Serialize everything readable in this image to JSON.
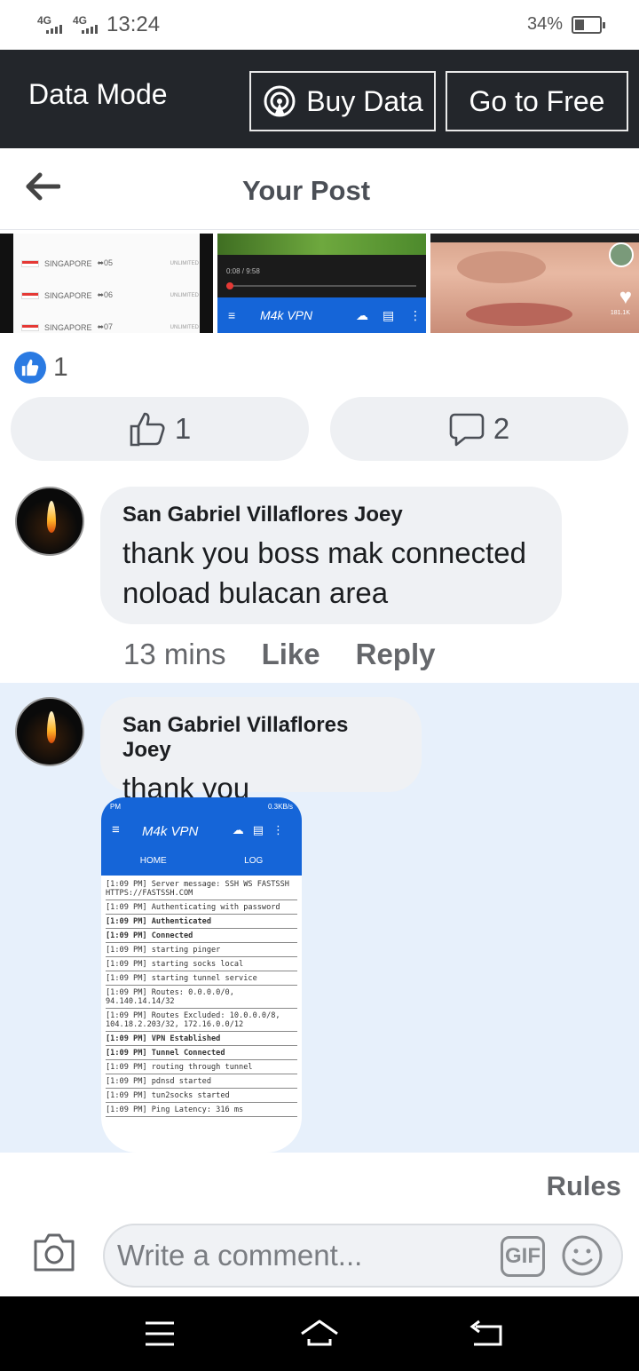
{
  "status_bar": {
    "signal1": "4G",
    "signal2": "4G",
    "time": "13:24",
    "battery": "34%",
    "battery_level": 0.34
  },
  "data_banner": {
    "mode_label": "Data Mode",
    "buy_label": "Buy Data",
    "free_label": "Go to Free"
  },
  "header": {
    "title": "Your Post"
  },
  "thumbnails": {
    "servers": [
      {
        "name": "SINGAPORE",
        "suffix": "05",
        "plan": "UNLIMITED"
      },
      {
        "name": "SINGAPORE",
        "suffix": "06",
        "plan": "UNLIMITED"
      },
      {
        "name": "SINGAPORE",
        "suffix": "07",
        "plan": "UNLIMITED"
      }
    ],
    "video_time": "0:08 / 9:58",
    "video_app": "M4k VPN",
    "like_count_small": "181.1K"
  },
  "reactions": {
    "count": "1"
  },
  "actions": {
    "like_count": "1",
    "comment_count": "2"
  },
  "comments": [
    {
      "author": "San Gabriel Villaflores Joey",
      "text": "thank you boss mak connected noload bulacan area",
      "time": "13 mins",
      "like": "Like",
      "reply": "Reply"
    },
    {
      "author": "San Gabriel Villaflores Joey",
      "text": "thank you"
    }
  ],
  "attachment": {
    "status_time": "PM",
    "status_right": "0.3KB/s",
    "title": "M4k VPN",
    "tab_home": "HOME",
    "tab_log": "LOG",
    "log": [
      {
        "text": "[1:09 PM] Server message: SSH WS FASTSSH HTTPS://FASTSSH.COM",
        "bold": false
      },
      {
        "text": "[1:09 PM] Authenticating with password",
        "bold": false
      },
      {
        "text": "[1:09 PM] Authenticated",
        "bold": true
      },
      {
        "text": "[1:09 PM] Connected",
        "bold": true
      },
      {
        "text": "[1:09 PM] starting pinger",
        "bold": false
      },
      {
        "text": "[1:09 PM] starting socks local",
        "bold": false
      },
      {
        "text": "[1:09 PM] starting tunnel service",
        "bold": false
      },
      {
        "text": "[1:09 PM] Routes: 0.0.0.0/0, 94.140.14.14/32",
        "bold": false
      },
      {
        "text": "[1:09 PM] Routes Excluded: 10.0.0.0/8, 104.18.2.203/32, 172.16.0.0/12",
        "bold": false
      },
      {
        "text": "[1:09 PM] VPN Established",
        "bold": true
      },
      {
        "text": "[1:09 PM] Tunnel Connected",
        "bold": true
      },
      {
        "text": "[1:09 PM] routing through tunnel",
        "bold": false
      },
      {
        "text": "[1:09 PM] pdnsd started",
        "bold": false
      },
      {
        "text": "[1:09 PM] tun2socks started",
        "bold": false
      },
      {
        "text": "[1:09 PM] Ping Latency: 316 ms",
        "bold": false
      }
    ]
  },
  "footer": {
    "rules": "Rules",
    "comment_placeholder": "Write a comment...",
    "gif_label": "GIF"
  },
  "colors": {
    "banner_bg": "#23262b",
    "reply_highlight": "#e7f0fb",
    "like_blue": "#2a7ae2",
    "vpn_blue": "#1565d8"
  }
}
